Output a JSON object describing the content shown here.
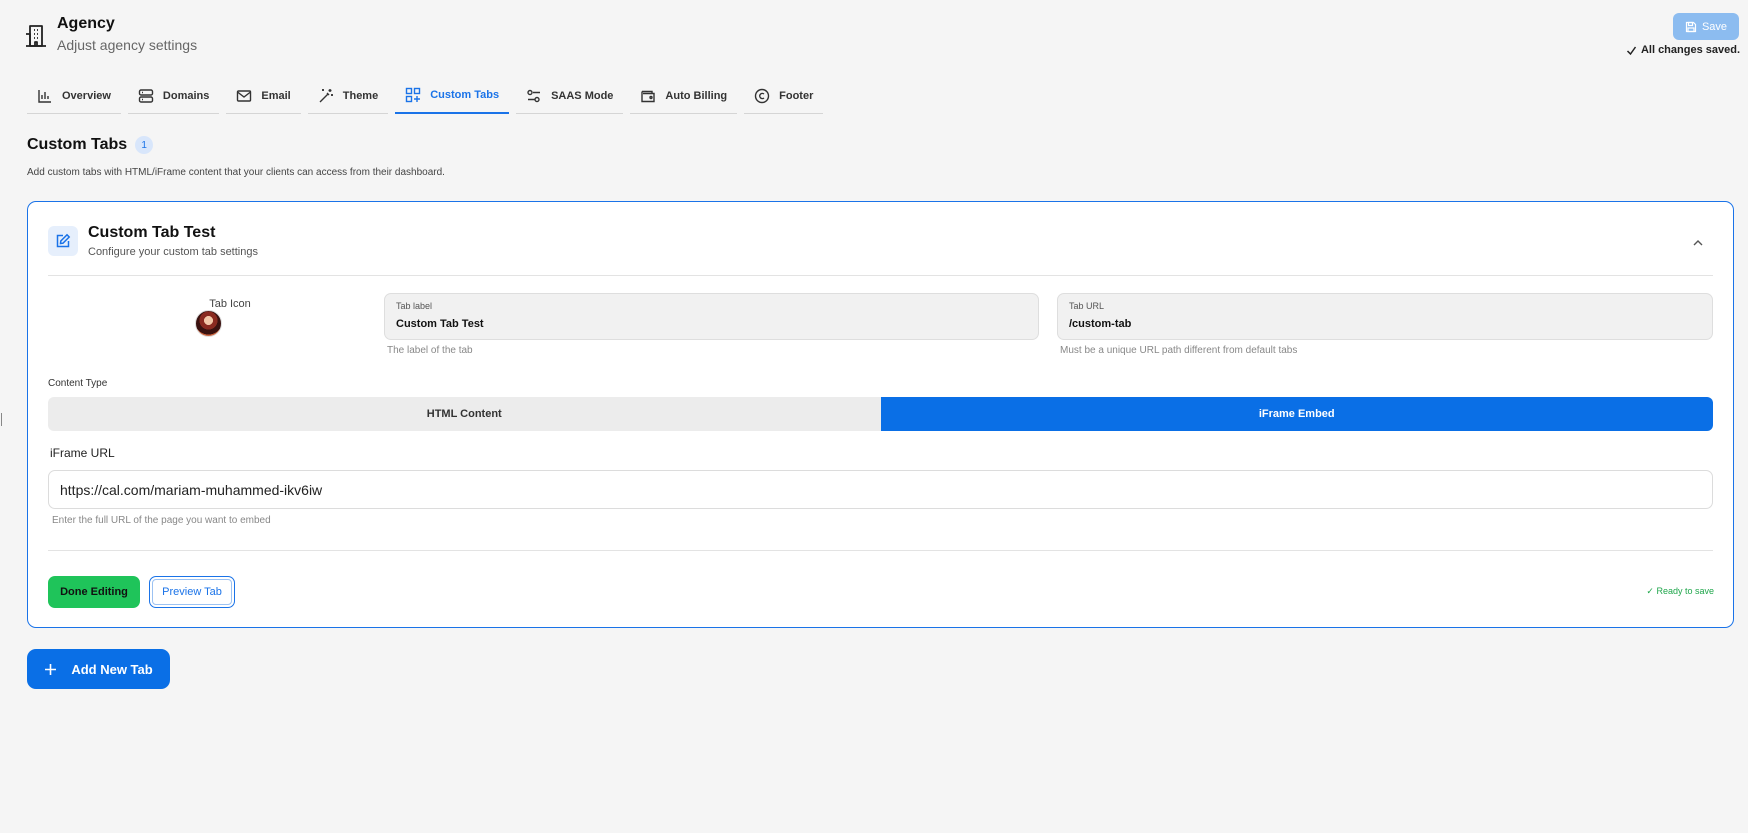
{
  "header": {
    "title": "Agency",
    "subtitle": "Adjust agency settings",
    "save_label": "Save",
    "saved_status": "All changes saved."
  },
  "tabs": [
    {
      "label": "Overview",
      "icon": "bar-chart-icon",
      "active": false
    },
    {
      "label": "Domains",
      "icon": "server-icon",
      "active": false
    },
    {
      "label": "Email",
      "icon": "mail-icon",
      "active": false
    },
    {
      "label": "Theme",
      "icon": "magic-wand-icon",
      "active": false
    },
    {
      "label": "Custom Tabs",
      "icon": "layout-plus-icon",
      "active": true
    },
    {
      "label": "SAAS Mode",
      "icon": "sliders-icon",
      "active": false
    },
    {
      "label": "Auto Billing",
      "icon": "wallet-icon",
      "active": false
    },
    {
      "label": "Footer",
      "icon": "copyright-icon",
      "active": false
    }
  ],
  "section": {
    "title": "Custom Tabs",
    "count": "1",
    "description": "Add custom tabs with HTML/iFrame content that your clients can access from their dashboard."
  },
  "card": {
    "title": "Custom Tab Test",
    "subtitle": "Configure your custom tab settings",
    "tab_icon_label": "Tab Icon",
    "tab_label": {
      "label": "Tab label",
      "value": "Custom Tab Test",
      "helper": "The label of the tab"
    },
    "tab_url": {
      "label": "Tab URL",
      "value": "/custom-tab",
      "helper": "Must be a unique URL path different from default tabs"
    },
    "content_type": {
      "label": "Content Type",
      "options": [
        "HTML Content",
        "iFrame Embed"
      ],
      "selected": "iFrame Embed"
    },
    "iframe_url": {
      "label": "iFrame URL",
      "value": "https://cal.com/mariam-muhammed-ikv6iw",
      "helper": "Enter the full URL of the page you want to embed"
    },
    "done_label": "Done Editing",
    "preview_label": "Preview Tab",
    "ready_status": "✓ Ready to save"
  },
  "add_button_label": "Add New Tab",
  "colors": {
    "accent": "#0a6fe6",
    "success": "#1fc45a",
    "background": "#f5f5f5"
  }
}
